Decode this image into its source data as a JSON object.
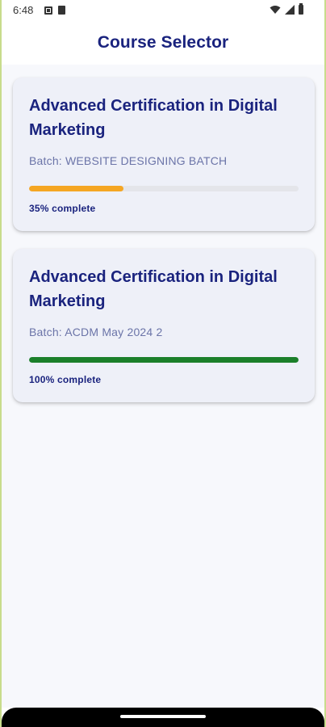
{
  "status_bar": {
    "time": "6:48",
    "left_icons": [
      "notification-app-icon",
      "sim-card-icon"
    ],
    "right_icons": [
      "wifi-icon",
      "signal-icon",
      "battery-icon"
    ]
  },
  "app_bar": {
    "title": "Course Selector",
    "title_color": "#1a237e"
  },
  "courses": [
    {
      "title": "Advanced Certification in Digital Marketing",
      "batch": "Batch: WEBSITE DESIGNING BATCH",
      "progress_percent": 35,
      "progress_label": "35% complete",
      "progress_color": "#f5a623"
    },
    {
      "title": "Advanced Certification in Digital Marketing",
      "batch": "Batch: ACDM May 2024 2",
      "progress_percent": 100,
      "progress_label": "100% complete",
      "progress_color": "#1b7f2a"
    }
  ],
  "colors": {
    "accent": "#1a237e",
    "background": "#f7f8fc",
    "card": "#eef0f8",
    "track": "#e4e5ea"
  }
}
